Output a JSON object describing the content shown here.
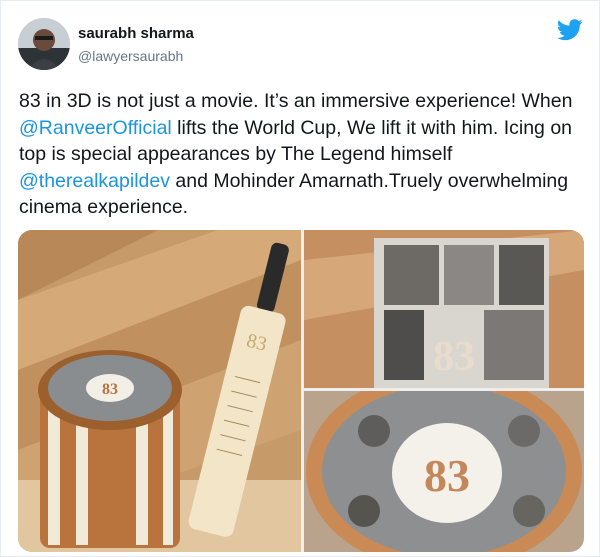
{
  "user": {
    "display_name": "saurabh sharma",
    "handle": "@lawyersaurabh"
  },
  "tweet": {
    "text_1": "83 in 3D is not just a movie. It’s an immersive experience! When ",
    "mention_1": "@RanveerOfficial",
    "text_2": " lifts the World Cup, We lift it with him. Icing on top is special appearances by The Legend himself ",
    "mention_2": "@therealkapildev",
    "text_3": " and Mohinder Amarnath.Truely overwhelming cinema experience."
  },
  "photos": {
    "main_tin_label": "83",
    "bat_label": "83",
    "box_label": "83",
    "lid_label": "83"
  },
  "icons": {
    "logo": "twitter-bird-icon"
  },
  "colors": {
    "accent": "#1da1f2",
    "mention": "#1b95e0",
    "text": "#14171a",
    "secondary": "#657786"
  }
}
